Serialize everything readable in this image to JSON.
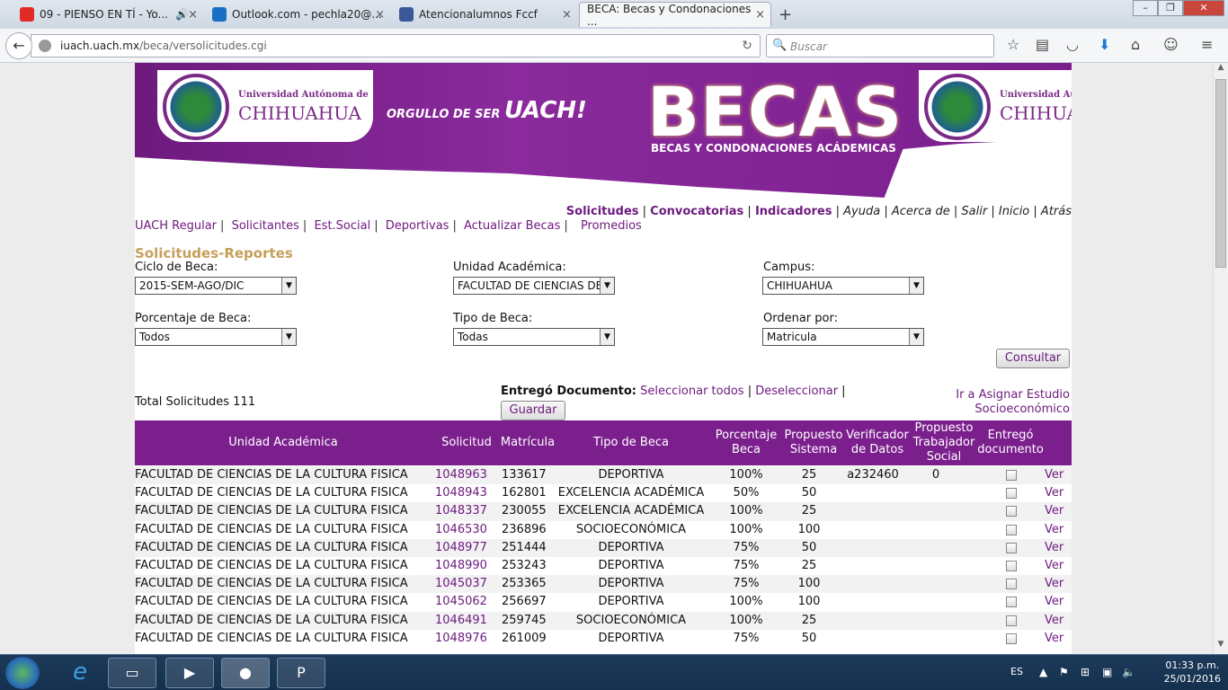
{
  "browser": {
    "tabs": [
      {
        "label": "09 - PIENSO EN TÍ - Yo...",
        "color": "#e22b25"
      },
      {
        "label": "Outlook.com - pechla20@...",
        "color": "#1a6fc4"
      },
      {
        "label": "Atencionalumnos Fccf",
        "color": "#3b5998"
      },
      {
        "label": "BECA: Becas y Condonaciones ...",
        "color": "#ffffff"
      }
    ],
    "new_tab": "+",
    "url_host": "iuach.uach.mx",
    "url_path": "/beca/versolicitudes.cgi",
    "search_placeholder": "Buscar"
  },
  "banner": {
    "uni_line1": "Universidad Autónoma de",
    "uni_line2": "CHIHUAHUA",
    "orgullo": "ORGULLO DE SER",
    "uach": "UACH!",
    "title": "BECAS",
    "subtitle": "BECAS Y CONDONACIONES ACÁDEMICAS"
  },
  "topnav": {
    "solicitudes": "Solicitudes",
    "convocatorias": "Convocatorias",
    "indicadores": "Indicadores",
    "ayuda": "Ayuda",
    "acerca": "Acerca de",
    "salir": "Salir",
    "inicio": "Inicio",
    "atras": "Atrás"
  },
  "subnav": {
    "regular": "UACH Regular",
    "solicitantes": "Solicitantes",
    "estsocial": "Est.Social",
    "deportivas": "Deportivas",
    "actualizar": "Actualizar Becas",
    "promedios": "Promedios"
  },
  "form": {
    "section_title": "Solicitudes-Reportes",
    "ciclo_label": "Ciclo de Beca:",
    "ciclo_value": "2015-SEM-AGO/DIC",
    "unidad_label": "Unidad Académica:",
    "unidad_value": "FACULTAD DE CIENCIAS DE",
    "campus_label": "Campus:",
    "campus_value": "CHIHUAHUA",
    "porcentaje_label": "Porcentaje de Beca:",
    "porcentaje_value": "Todos",
    "tipo_label": "Tipo de Beca:",
    "tipo_value": "Todas",
    "ordenar_label": "Ordenar por:",
    "ordenar_value": "Matricula",
    "consultar": "Consultar"
  },
  "summary": {
    "total": "Total Solicitudes 111",
    "entrego_label": "Entregó Documento:",
    "seleccionar": "Seleccionar todos",
    "deseleccionar": "Deseleccionar",
    "guardar": "Guardar",
    "asignar1": "Ir a Asignar Estudio",
    "asignar2": "Socioeconómico"
  },
  "table": {
    "headers": {
      "unidad": "Unidad Académica",
      "solicitud": "Solicitud",
      "matricula": "Matrícula",
      "tipo": "Tipo de Beca",
      "porcentaje1": "Porcentaje",
      "porcentaje2": "Beca",
      "propuesto1": "Propuesto",
      "propuesto2": "Sistema",
      "verificador1": "Verificador",
      "verificador2": "de Datos",
      "trabajador1": "Propuesto",
      "trabajador2": "Trabajador",
      "trabajador3": "Social",
      "entrego1": "Entregó",
      "entrego2": "documento"
    },
    "ver_label": "Ver",
    "rows": [
      {
        "unidad": "FACULTAD DE CIENCIAS DE LA CULTURA FISICA",
        "solicitud": "1048963",
        "matricula": "133617",
        "tipo": "DEPORTIVA",
        "porcentaje": "100%",
        "sistema": "25",
        "verificador": "a232460",
        "trabajador": "0"
      },
      {
        "unidad": "FACULTAD DE CIENCIAS DE LA CULTURA FISICA",
        "solicitud": "1048943",
        "matricula": "162801",
        "tipo": "EXCELENCIA ACADÉMICA",
        "porcentaje": "50%",
        "sistema": "50",
        "verificador": "",
        "trabajador": ""
      },
      {
        "unidad": "FACULTAD DE CIENCIAS DE LA CULTURA FISICA",
        "solicitud": "1048337",
        "matricula": "230055",
        "tipo": "EXCELENCIA ACADÉMICA",
        "porcentaje": "100%",
        "sistema": "25",
        "verificador": "",
        "trabajador": ""
      },
      {
        "unidad": "FACULTAD DE CIENCIAS DE LA CULTURA FISICA",
        "solicitud": "1046530",
        "matricula": "236896",
        "tipo": "SOCIOECONÓMICA",
        "porcentaje": "100%",
        "sistema": "100",
        "verificador": "",
        "trabajador": ""
      },
      {
        "unidad": "FACULTAD DE CIENCIAS DE LA CULTURA FISICA",
        "solicitud": "1048977",
        "matricula": "251444",
        "tipo": "DEPORTIVA",
        "porcentaje": "75%",
        "sistema": "50",
        "verificador": "",
        "trabajador": ""
      },
      {
        "unidad": "FACULTAD DE CIENCIAS DE LA CULTURA FISICA",
        "solicitud": "1048990",
        "matricula": "253243",
        "tipo": "DEPORTIVA",
        "porcentaje": "75%",
        "sistema": "25",
        "verificador": "",
        "trabajador": ""
      },
      {
        "unidad": "FACULTAD DE CIENCIAS DE LA CULTURA FISICA",
        "solicitud": "1045037",
        "matricula": "253365",
        "tipo": "DEPORTIVA",
        "porcentaje": "75%",
        "sistema": "100",
        "verificador": "",
        "trabajador": ""
      },
      {
        "unidad": "FACULTAD DE CIENCIAS DE LA CULTURA FISICA",
        "solicitud": "1045062",
        "matricula": "256697",
        "tipo": "DEPORTIVA",
        "porcentaje": "100%",
        "sistema": "100",
        "verificador": "",
        "trabajador": ""
      },
      {
        "unidad": "FACULTAD DE CIENCIAS DE LA CULTURA FISICA",
        "solicitud": "1046491",
        "matricula": "259745",
        "tipo": "SOCIOECONÓMICA",
        "porcentaje": "100%",
        "sistema": "25",
        "verificador": "",
        "trabajador": ""
      },
      {
        "unidad": "FACULTAD DE CIENCIAS DE LA CULTURA FISICA",
        "solicitud": "1048976",
        "matricula": "261009",
        "tipo": "DEPORTIVA",
        "porcentaje": "75%",
        "sistema": "50",
        "verificador": "",
        "trabajador": ""
      }
    ]
  },
  "taskbar": {
    "lang": "ES",
    "time": "01:33 p.m.",
    "date": "25/01/2016"
  }
}
